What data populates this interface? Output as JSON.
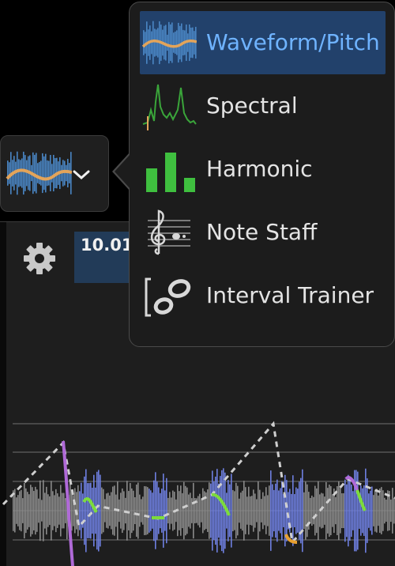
{
  "view_button": {
    "current_view": "Waveform/Pitch",
    "icon": "waveform-pitch-icon",
    "chevron": "chevron-down-icon"
  },
  "menu": {
    "items": [
      {
        "label": "Waveform/Pitch",
        "icon": "waveform-pitch-icon",
        "selected": true
      },
      {
        "label": "Spectral",
        "icon": "spectral-icon",
        "selected": false
      },
      {
        "label": "Harmonic",
        "icon": "harmonic-bars-icon",
        "selected": false
      },
      {
        "label": "Note Staff",
        "icon": "treble-clef-icon",
        "selected": false
      },
      {
        "label": "Interval Trainer",
        "icon": "interval-trainer-icon",
        "selected": false
      }
    ]
  },
  "toolbar": {
    "settings_icon": "gear-icon",
    "time_readout": "10.01"
  },
  "colors": {
    "selected_bg": "#22416b",
    "selected_text": "#6fb3ff",
    "waveform_gray": "#8a8a8a",
    "waveform_blue": "#6e7fe0",
    "pitch_green": "#7ddc3c",
    "pitch_purple": "#b06ad8",
    "pitch_orange": "#e8a030"
  }
}
